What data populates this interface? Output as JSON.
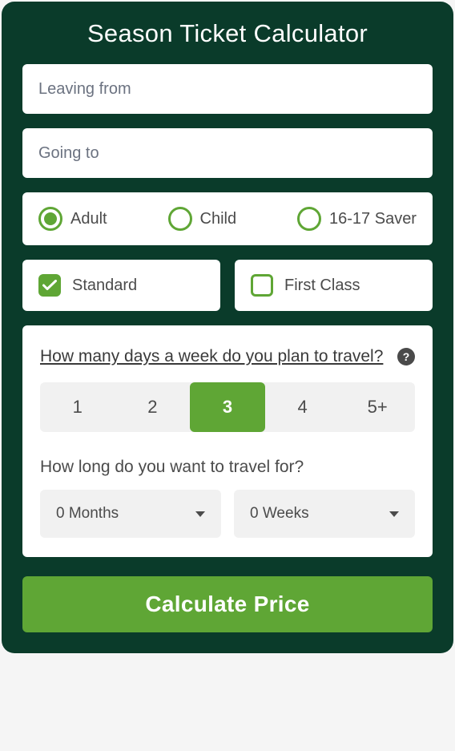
{
  "title": "Season Ticket Calculator",
  "inputs": {
    "from_placeholder": "Leaving from",
    "to_placeholder": "Going to"
  },
  "passenger_types": {
    "adult": "Adult",
    "child": "Child",
    "saver_16_17": "16-17 Saver",
    "selected": "adult"
  },
  "classes": {
    "standard": "Standard",
    "first": "First Class",
    "standard_checked": true,
    "first_checked": false
  },
  "days": {
    "question": "How many days a week do you plan to travel?",
    "help": "?",
    "options": [
      "1",
      "2",
      "3",
      "4",
      "5+"
    ],
    "selected": "3"
  },
  "duration": {
    "label": "How long do you want to travel for?",
    "months": "0 Months",
    "weeks": "0 Weeks"
  },
  "submit": "Calculate Price"
}
